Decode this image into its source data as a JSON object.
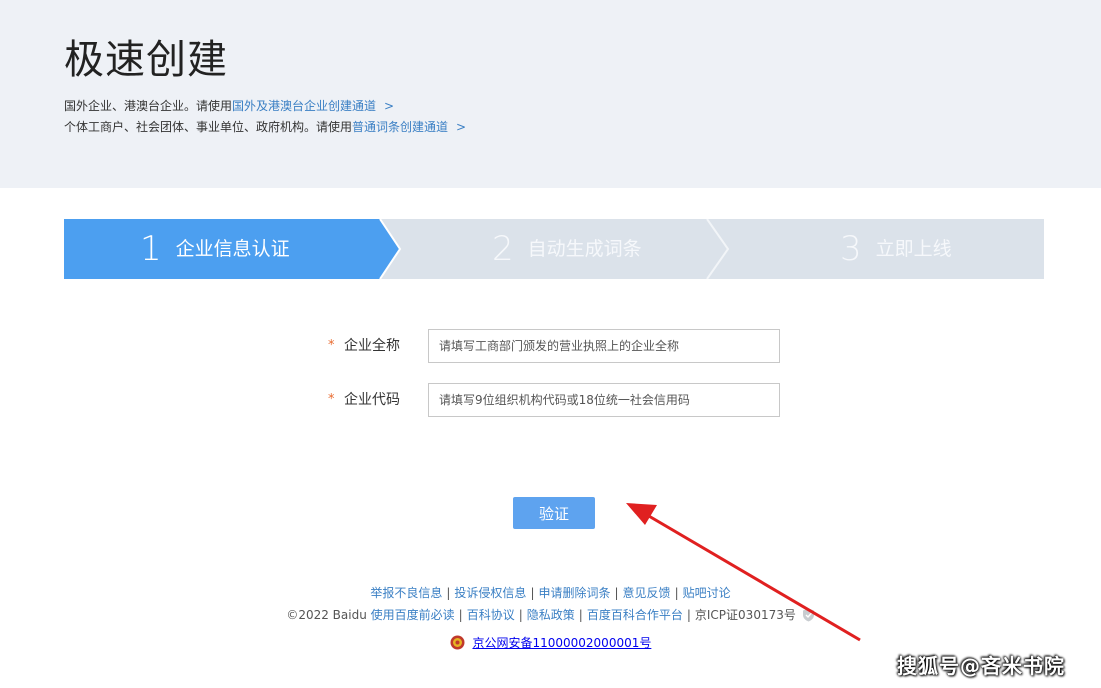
{
  "hero": {
    "title": "极速创建",
    "line1_prefix": "国外企业、港澳台企业。请使用",
    "line1_link": "国外及港澳台企业创建通道",
    "line1_chevron": ">",
    "line2_prefix": "个体工商户、社会团体、事业单位、政府机构。请使用",
    "line2_link": "普通词条创建通道",
    "line2_chevron": ">"
  },
  "steps": [
    {
      "num": "1",
      "label": "企业信息认证",
      "active": true
    },
    {
      "num": "2",
      "label": "自动生成词条",
      "active": false
    },
    {
      "num": "3",
      "label": "立即上线",
      "active": false
    }
  ],
  "form": {
    "required_mark": "*",
    "fields": [
      {
        "label": "企业全称",
        "placeholder": "请填写工商部门颁发的营业执照上的企业全称",
        "value": ""
      },
      {
        "label": "企业代码",
        "placeholder": "请填写9位组织机构代码或18位统一社会信用码",
        "value": ""
      }
    ],
    "submit_label": "验证"
  },
  "footer": {
    "links": [
      "举报不良信息",
      "投诉侵权信息",
      "申请删除词条",
      "意见反馈",
      "贴吧讨论"
    ],
    "separator": "|",
    "copyright": "©2022 Baidu",
    "copy_links": [
      "使用百度前必读",
      "百科协议",
      "隐私政策",
      "百度百科合作平台"
    ],
    "icp": "京ICP证030173号",
    "police": "京公网安备11000002000001号"
  },
  "watermark": "搜狐号@吝米书院",
  "colors": {
    "accent": "#4c9ff0",
    "step_inactive": "#dbe2ea",
    "link": "#3a7fc4",
    "button": "#5ea3ef",
    "required": "#e86a2f",
    "arrow": "#e02020"
  },
  "icons": {
    "shield": "shield-icon",
    "police": "police-badge-icon"
  }
}
